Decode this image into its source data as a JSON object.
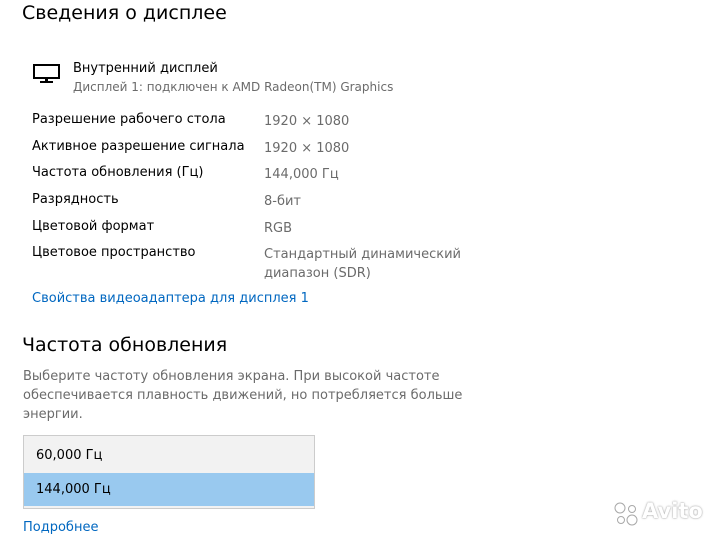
{
  "header": {
    "title": "Сведения о дисплее"
  },
  "display": {
    "icon": "monitor-icon",
    "name": "Внутренний дисплей",
    "subtitle": "Дисплей 1: подключен к AMD Radeon(TM) Graphics"
  },
  "info": [
    {
      "label": "Разрешение рабочего стола",
      "value": "1920 × 1080"
    },
    {
      "label": "Активное разрешение сигнала",
      "value": "1920 × 1080"
    },
    {
      "label": "Частота обновления (Гц)",
      "value": "144,000 Гц"
    },
    {
      "label": "Разрядность",
      "value": "8-бит"
    },
    {
      "label": "Цветовой формат",
      "value": "RGB"
    },
    {
      "label": "Цветовое пространство",
      "value": "Стандартный динамический диапазон (SDR)"
    }
  ],
  "adapter_link": "Свойства видеоадаптера для дисплея 1",
  "refresh": {
    "title": "Частота обновления",
    "description": "Выберите частоту обновления экрана. При высокой частоте обеспечивается плавность движений, но потребляется больше энергии.",
    "options": [
      "60,000 Гц",
      "144,000 Гц"
    ],
    "selected": "144,000 Гц",
    "more_link": "Подробнее"
  },
  "watermark": {
    "text": "Avito"
  },
  "colors": {
    "link": "#0067c0",
    "secondary_text": "#6b6b6b",
    "selected_option": "#99c9ef",
    "dropdown_bg": "#f2f2f2"
  }
}
